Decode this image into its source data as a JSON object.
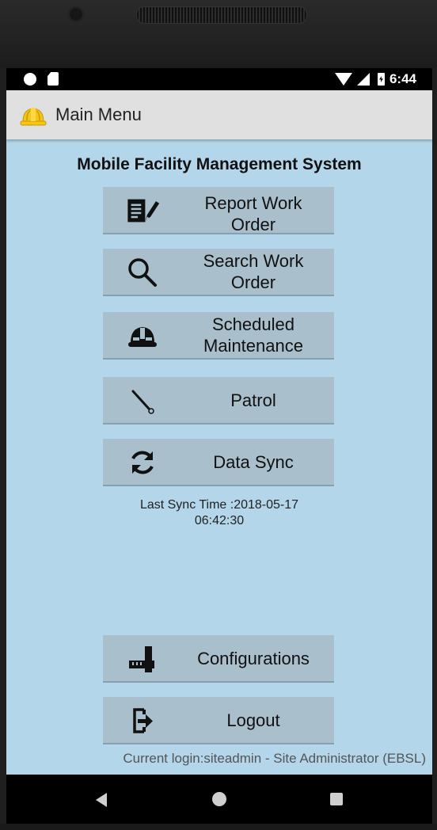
{
  "status_bar": {
    "time": "6:44"
  },
  "app_bar": {
    "title": "Main Menu",
    "icon": "hard-hat-icon"
  },
  "system_title": "Mobile Facility Management System",
  "menu": [
    {
      "label": "Report Work\nOrder",
      "icon": "report-edit-icon"
    },
    {
      "label": "Search Work\nOrder",
      "icon": "search-icon"
    },
    {
      "label": "Scheduled\nMaintenance",
      "icon": "helmet-icon"
    },
    {
      "label": "Patrol",
      "icon": "baton-icon"
    },
    {
      "label": "Data Sync",
      "icon": "sync-icon"
    }
  ],
  "last_sync": {
    "line1": "Last Sync Time :2018-05-17",
    "line2": "06:42:30"
  },
  "bottom_menu": [
    {
      "label": "Configurations",
      "icon": "ruler-tools-icon"
    },
    {
      "label": "Logout",
      "icon": "logout-icon"
    }
  ],
  "current_login": "Current login:siteadmin - Site Administrator (EBSL)",
  "colors": {
    "screen_bg": "#b3d6ea",
    "button_bg": "#a9bfcc",
    "app_bar_bg": "#e0e0e0",
    "accent_helmet": "#f5c518"
  }
}
